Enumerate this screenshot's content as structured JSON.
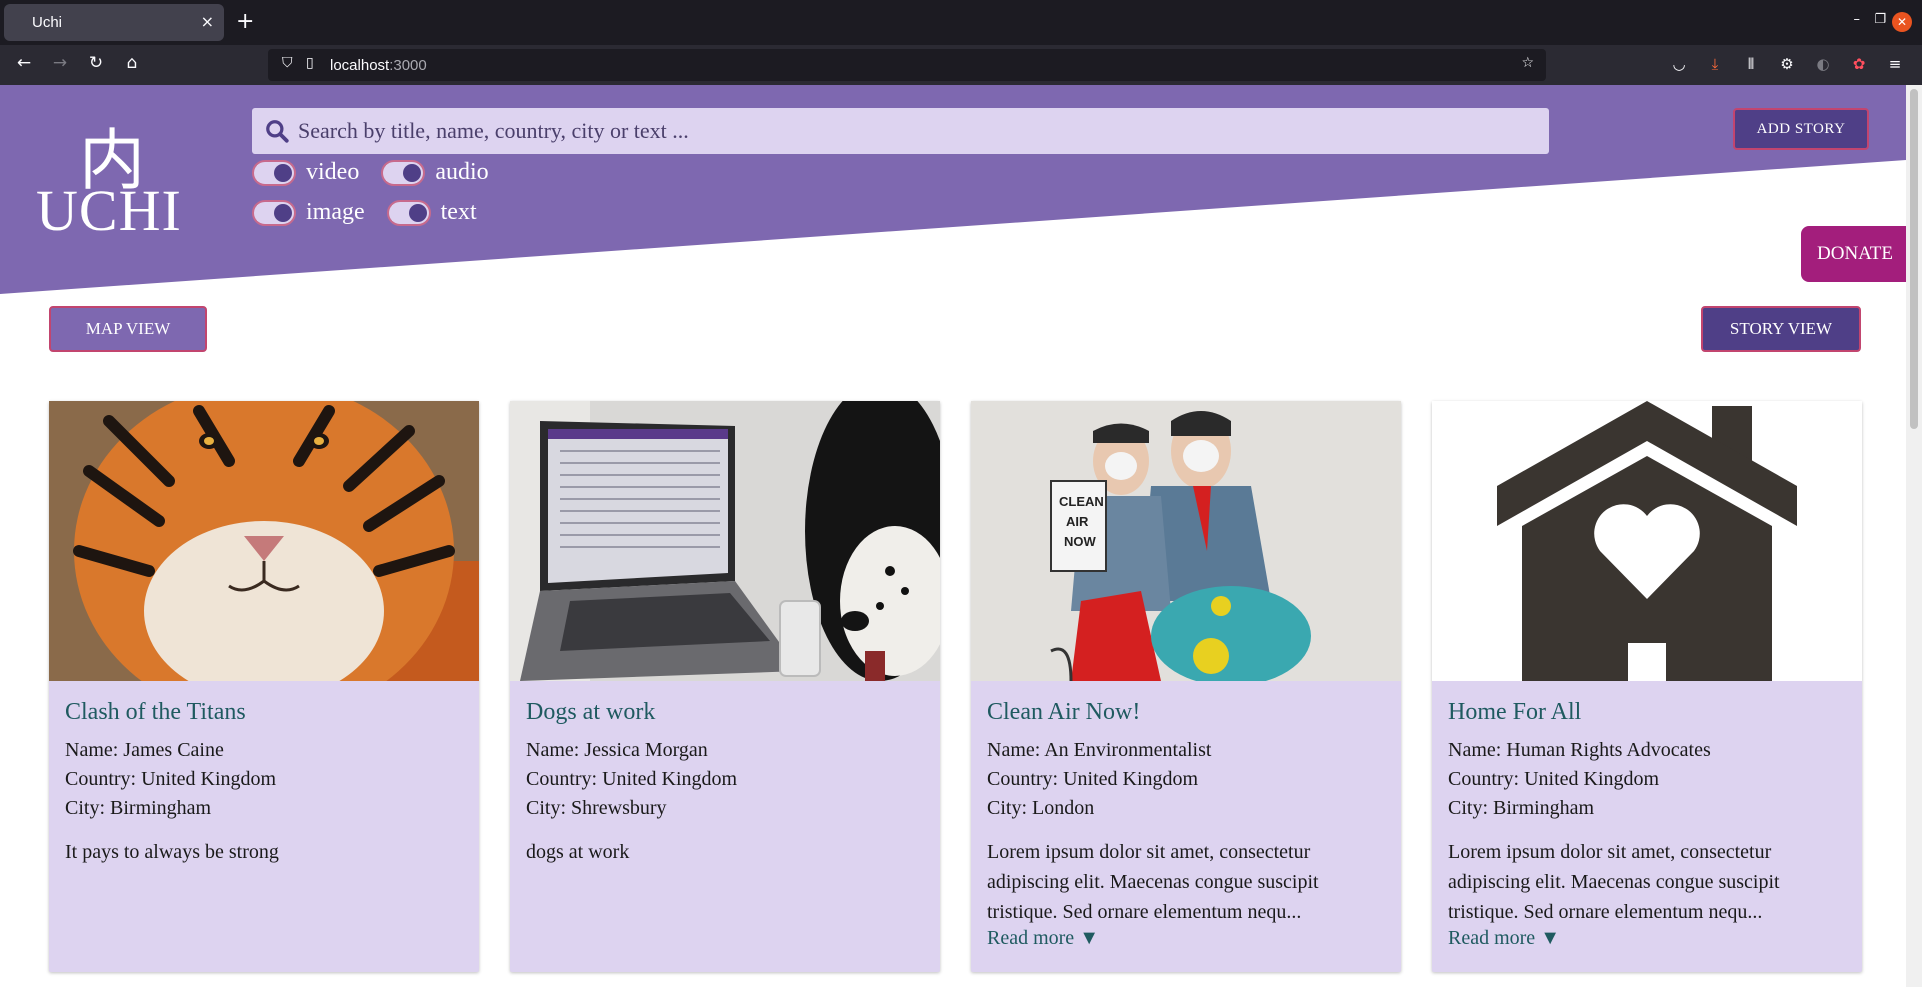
{
  "browser": {
    "tab_title": "Uchi",
    "tab_close": "×",
    "new_tab": "+",
    "url_host": "localhost",
    "url_port": ":3000"
  },
  "header": {
    "logo_char": "内",
    "logo_text": "UCHI",
    "search_placeholder": "Search by title, name, country, city or text ...",
    "toggles": [
      {
        "label": "video",
        "on": true
      },
      {
        "label": "audio",
        "on": true
      },
      {
        "label": "image",
        "on": true
      },
      {
        "label": "text",
        "on": true
      }
    ],
    "add_story": "Add Story",
    "donate": "Donate",
    "colors": {
      "header": "#7e68b0",
      "dark": "#4f3f87",
      "accent": "#a31e7c",
      "card": "#ddd3f0",
      "title": "#1f5a60"
    }
  },
  "views": {
    "map_view": "Map View",
    "story_view": "Story View"
  },
  "cards": [
    {
      "title": "Clash of the Titans",
      "name": "Name: James Caine",
      "country": "Country: United Kingdom",
      "city": "City:  Birmingham",
      "text": "It pays to always be strong",
      "read_more": "",
      "image": "tiger-image"
    },
    {
      "title": "Dogs at work",
      "name": "Name: Jessica Morgan",
      "country": "Country: United Kingdom",
      "city": "City:  Shrewsbury",
      "text": "dogs at work",
      "read_more": "",
      "image": "dog-laptop-image"
    },
    {
      "title": "Clean Air Now!",
      "name": "Name: An Environmentalist",
      "country": "Country: United Kingdom",
      "city": "City:  London",
      "text": "Lorem ipsum dolor sit amet, consectetur adipiscing elit. Maecenas congue suscipit tristique. Sed ornare elementum nequ...",
      "read_more": "Read more ▼",
      "image": "street-art-image"
    },
    {
      "title": "Home For All",
      "name": "Name: Human Rights Advocates",
      "country": "Country: United Kingdom",
      "city": "City:  Birmingham",
      "text": "Lorem ipsum dolor sit amet, consectetur adipiscing elit. Maecenas congue suscipit tristique. Sed ornare elementum nequ...",
      "read_more": "Read more ▼",
      "image": "house-heart-image"
    }
  ]
}
